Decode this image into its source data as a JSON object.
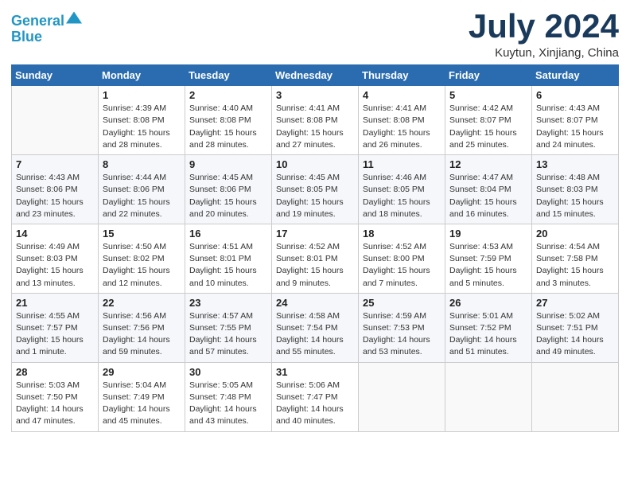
{
  "header": {
    "logo_line1": "General",
    "logo_line2": "Blue",
    "month": "July 2024",
    "location": "Kuytun, Xinjiang, China"
  },
  "weekdays": [
    "Sunday",
    "Monday",
    "Tuesday",
    "Wednesday",
    "Thursday",
    "Friday",
    "Saturday"
  ],
  "weeks": [
    [
      {
        "day": "",
        "info": ""
      },
      {
        "day": "1",
        "info": "Sunrise: 4:39 AM\nSunset: 8:08 PM\nDaylight: 15 hours\nand 28 minutes."
      },
      {
        "day": "2",
        "info": "Sunrise: 4:40 AM\nSunset: 8:08 PM\nDaylight: 15 hours\nand 28 minutes."
      },
      {
        "day": "3",
        "info": "Sunrise: 4:41 AM\nSunset: 8:08 PM\nDaylight: 15 hours\nand 27 minutes."
      },
      {
        "day": "4",
        "info": "Sunrise: 4:41 AM\nSunset: 8:08 PM\nDaylight: 15 hours\nand 26 minutes."
      },
      {
        "day": "5",
        "info": "Sunrise: 4:42 AM\nSunset: 8:07 PM\nDaylight: 15 hours\nand 25 minutes."
      },
      {
        "day": "6",
        "info": "Sunrise: 4:43 AM\nSunset: 8:07 PM\nDaylight: 15 hours\nand 24 minutes."
      }
    ],
    [
      {
        "day": "7",
        "info": "Sunrise: 4:43 AM\nSunset: 8:06 PM\nDaylight: 15 hours\nand 23 minutes."
      },
      {
        "day": "8",
        "info": "Sunrise: 4:44 AM\nSunset: 8:06 PM\nDaylight: 15 hours\nand 22 minutes."
      },
      {
        "day": "9",
        "info": "Sunrise: 4:45 AM\nSunset: 8:06 PM\nDaylight: 15 hours\nand 20 minutes."
      },
      {
        "day": "10",
        "info": "Sunrise: 4:45 AM\nSunset: 8:05 PM\nDaylight: 15 hours\nand 19 minutes."
      },
      {
        "day": "11",
        "info": "Sunrise: 4:46 AM\nSunset: 8:05 PM\nDaylight: 15 hours\nand 18 minutes."
      },
      {
        "day": "12",
        "info": "Sunrise: 4:47 AM\nSunset: 8:04 PM\nDaylight: 15 hours\nand 16 minutes."
      },
      {
        "day": "13",
        "info": "Sunrise: 4:48 AM\nSunset: 8:03 PM\nDaylight: 15 hours\nand 15 minutes."
      }
    ],
    [
      {
        "day": "14",
        "info": "Sunrise: 4:49 AM\nSunset: 8:03 PM\nDaylight: 15 hours\nand 13 minutes."
      },
      {
        "day": "15",
        "info": "Sunrise: 4:50 AM\nSunset: 8:02 PM\nDaylight: 15 hours\nand 12 minutes."
      },
      {
        "day": "16",
        "info": "Sunrise: 4:51 AM\nSunset: 8:01 PM\nDaylight: 15 hours\nand 10 minutes."
      },
      {
        "day": "17",
        "info": "Sunrise: 4:52 AM\nSunset: 8:01 PM\nDaylight: 15 hours\nand 9 minutes."
      },
      {
        "day": "18",
        "info": "Sunrise: 4:52 AM\nSunset: 8:00 PM\nDaylight: 15 hours\nand 7 minutes."
      },
      {
        "day": "19",
        "info": "Sunrise: 4:53 AM\nSunset: 7:59 PM\nDaylight: 15 hours\nand 5 minutes."
      },
      {
        "day": "20",
        "info": "Sunrise: 4:54 AM\nSunset: 7:58 PM\nDaylight: 15 hours\nand 3 minutes."
      }
    ],
    [
      {
        "day": "21",
        "info": "Sunrise: 4:55 AM\nSunset: 7:57 PM\nDaylight: 15 hours\nand 1 minute."
      },
      {
        "day": "22",
        "info": "Sunrise: 4:56 AM\nSunset: 7:56 PM\nDaylight: 14 hours\nand 59 minutes."
      },
      {
        "day": "23",
        "info": "Sunrise: 4:57 AM\nSunset: 7:55 PM\nDaylight: 14 hours\nand 57 minutes."
      },
      {
        "day": "24",
        "info": "Sunrise: 4:58 AM\nSunset: 7:54 PM\nDaylight: 14 hours\nand 55 minutes."
      },
      {
        "day": "25",
        "info": "Sunrise: 4:59 AM\nSunset: 7:53 PM\nDaylight: 14 hours\nand 53 minutes."
      },
      {
        "day": "26",
        "info": "Sunrise: 5:01 AM\nSunset: 7:52 PM\nDaylight: 14 hours\nand 51 minutes."
      },
      {
        "day": "27",
        "info": "Sunrise: 5:02 AM\nSunset: 7:51 PM\nDaylight: 14 hours\nand 49 minutes."
      }
    ],
    [
      {
        "day": "28",
        "info": "Sunrise: 5:03 AM\nSunset: 7:50 PM\nDaylight: 14 hours\nand 47 minutes."
      },
      {
        "day": "29",
        "info": "Sunrise: 5:04 AM\nSunset: 7:49 PM\nDaylight: 14 hours\nand 45 minutes."
      },
      {
        "day": "30",
        "info": "Sunrise: 5:05 AM\nSunset: 7:48 PM\nDaylight: 14 hours\nand 43 minutes."
      },
      {
        "day": "31",
        "info": "Sunrise: 5:06 AM\nSunset: 7:47 PM\nDaylight: 14 hours\nand 40 minutes."
      },
      {
        "day": "",
        "info": ""
      },
      {
        "day": "",
        "info": ""
      },
      {
        "day": "",
        "info": ""
      }
    ]
  ]
}
